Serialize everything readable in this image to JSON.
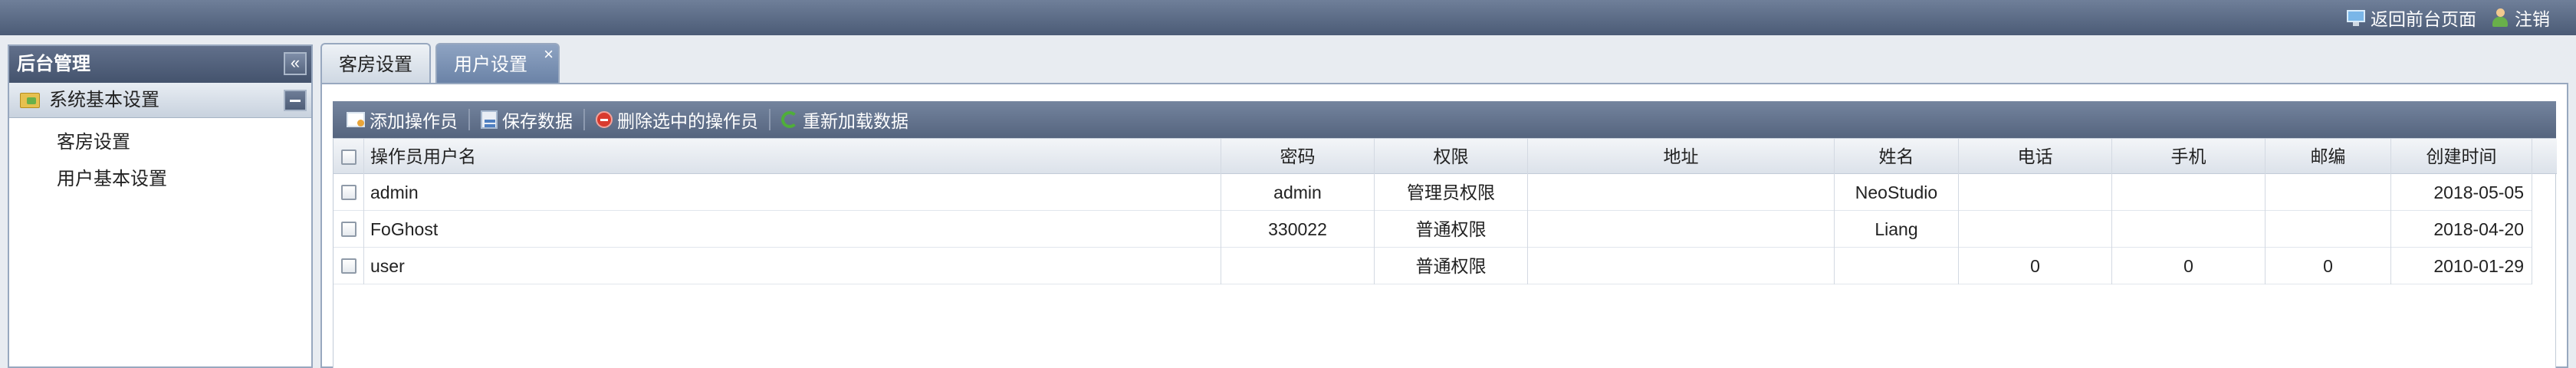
{
  "topbar": {
    "back_label": "返回前台页面",
    "logout_label": "注销"
  },
  "sidebar": {
    "title": "后台管理",
    "group_label": "系统基本设置",
    "items": [
      {
        "label": "客房设置"
      },
      {
        "label": "用户基本设置"
      }
    ]
  },
  "tabs": [
    {
      "label": "客房设置",
      "active": false
    },
    {
      "label": "用户设置",
      "active": true
    }
  ],
  "tab_close": "×",
  "toolbar": {
    "add_label": "添加操作员",
    "save_label": "保存数据",
    "delete_label": "删除选中的操作员",
    "reload_label": "重新加载数据"
  },
  "table": {
    "columns": [
      "操作员用户名",
      "密码",
      "权限",
      "地址",
      "姓名",
      "电话",
      "手机",
      "邮编",
      "创建时间"
    ],
    "rows": [
      {
        "username": "admin",
        "password": "admin",
        "permission": "管理员权限",
        "address": "",
        "name": "NeoStudio",
        "phone": "",
        "mobile": "",
        "zip": "",
        "created": "2018-05-05"
      },
      {
        "username": "FoGhost",
        "password": "330022",
        "permission": "普通权限",
        "address": "",
        "name": "Liang",
        "phone": "",
        "mobile": "",
        "zip": "",
        "created": "2018-04-20"
      },
      {
        "username": "user",
        "password": "",
        "permission": "普通权限",
        "address": "",
        "name": "",
        "phone": "0",
        "mobile": "0",
        "zip": "0",
        "created": "2010-01-29"
      }
    ]
  }
}
